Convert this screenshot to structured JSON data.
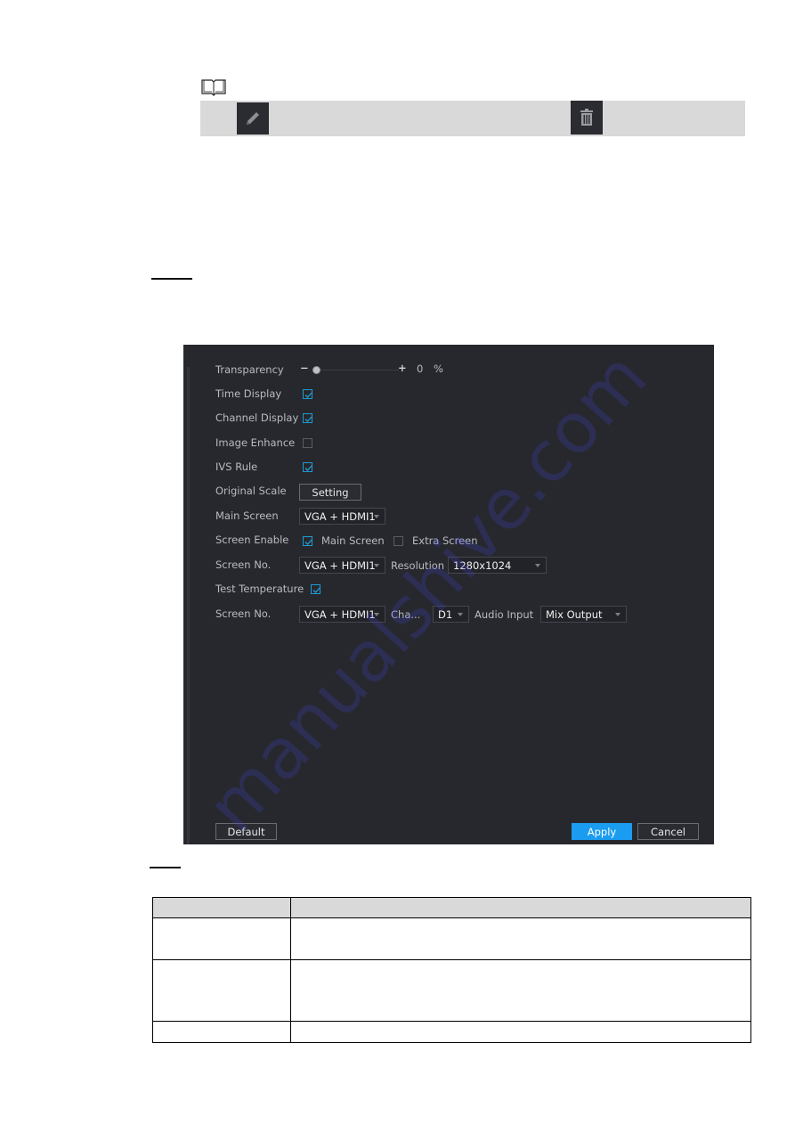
{
  "note": {
    "icon": "book-icon",
    "inline_icons": [
      "edit-pencil-icon",
      "delete-trash-icon"
    ]
  },
  "panel": {
    "transparency": {
      "label": "Transparency",
      "value": "0",
      "unit": "%",
      "minus": "−",
      "plus": "+",
      "fraction": 0.0
    },
    "time_display": {
      "label": "Time Display",
      "checked": true
    },
    "channel_display": {
      "label": "Channel Display",
      "checked": true
    },
    "image_enhance": {
      "label": "Image Enhance",
      "checked": false
    },
    "ivs_rule": {
      "label": "IVS Rule",
      "checked": true
    },
    "original_scale": {
      "label": "Original Scale",
      "button": "Setting"
    },
    "main_screen": {
      "label": "Main Screen",
      "value": "VGA + HDMI1"
    },
    "screen_enable": {
      "label": "Screen Enable",
      "main_label": "Main Screen",
      "main_checked": true,
      "extra_label": "Extra Screen",
      "extra_checked": false
    },
    "screen_no_1": {
      "label": "Screen No.",
      "value": "VGA + HDMI1",
      "resolution_label": "Resolution",
      "resolution_value": "1280x1024"
    },
    "test_temperature": {
      "label": "Test Temperature",
      "checked": true
    },
    "screen_no_2": {
      "label": "Screen No.",
      "value": "VGA + HDMI1",
      "channel_label": "Cha...",
      "channel_value": "D1",
      "audio_label": "Audio Input",
      "audio_value": "Mix Output"
    },
    "buttons": {
      "default": "Default",
      "apply": "Apply",
      "cancel": "Cancel"
    },
    "colors": {
      "background": "#27282d",
      "accent": "#1a9cf0",
      "checkbox": "#1f9ad6"
    }
  },
  "watermark": "manualshive.com",
  "table": {
    "rows": [
      {
        "c1": "",
        "c2": ""
      },
      {
        "c1": "",
        "c2": ""
      },
      {
        "c1": "",
        "c2": ""
      }
    ],
    "header": {
      "c1": "",
      "c2": ""
    }
  }
}
